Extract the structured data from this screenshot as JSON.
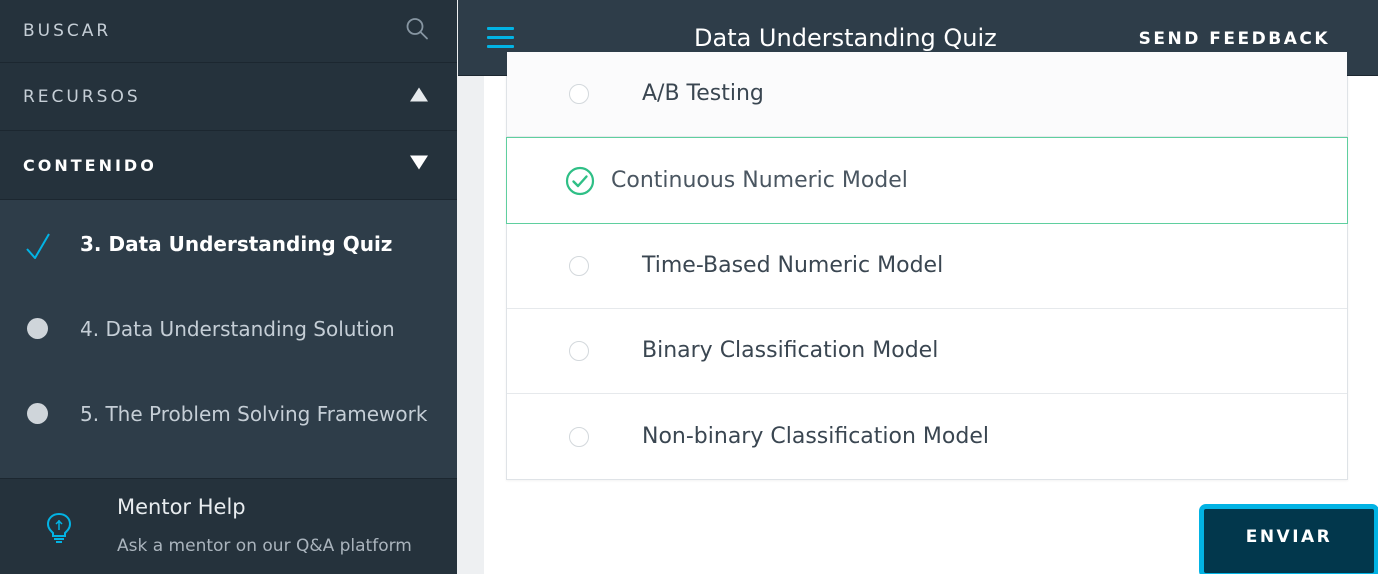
{
  "sidebar": {
    "search_label": "BUSCAR",
    "resources_label": "RECURSOS",
    "content_label": "CONTENIDO",
    "lessons": [
      {
        "label": "3. Data Understanding Quiz",
        "status": "completed"
      },
      {
        "label": "4. Data Understanding Solution",
        "status": "not-started"
      },
      {
        "label": "5. The Problem Solving Framework",
        "status": "not-started"
      }
    ],
    "mentor": {
      "title": "Mentor Help",
      "subtitle": "Ask a mentor on our Q&A platform"
    }
  },
  "header": {
    "title": "Data Understanding Quiz",
    "feedback_label": "SEND FEEDBACK"
  },
  "quiz": {
    "options": [
      {
        "label": "A/B Testing",
        "selected": false
      },
      {
        "label": "Continuous Numeric Model",
        "selected": true
      },
      {
        "label": "Time-Based Numeric Model",
        "selected": false
      },
      {
        "label": "Binary Classification Model",
        "selected": false
      },
      {
        "label": "Non-binary Classification Model",
        "selected": false
      }
    ],
    "submit_label": "ENVIAR"
  },
  "colors": {
    "accent": "#02b3e4",
    "success": "#2fbf86",
    "sidebar_bg": "#2e3d49",
    "button_bg": "#02374c"
  },
  "icons": [
    "search-icon",
    "triangle-up-icon",
    "triangle-down-icon",
    "checkmark-icon",
    "lightbulb-icon",
    "hamburger-icon",
    "check-circle-icon"
  ]
}
